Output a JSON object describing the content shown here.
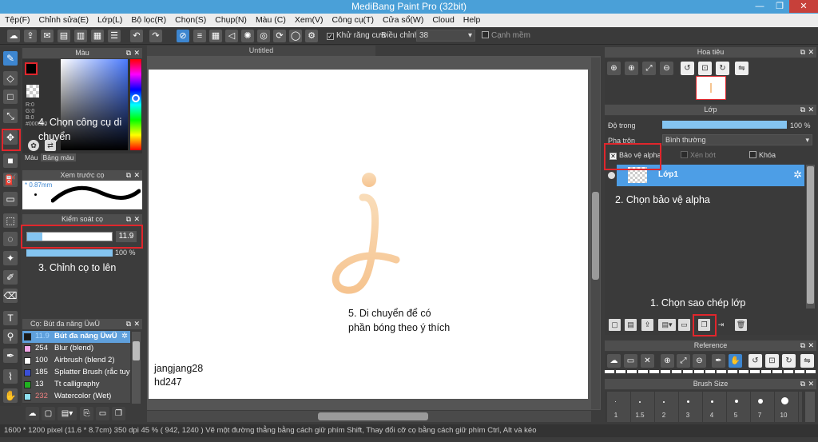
{
  "app": {
    "title": "MediBang Paint Pro (32bit)"
  },
  "menu": [
    "Tệp(F)",
    "Chỉnh sửa(E)",
    "Lớp(L)",
    "Bộ lọc(R)",
    "Chọn(S)",
    "Chụp(N)",
    "Màu (C)",
    "Xem(V)",
    "Công cụ(T)",
    "Cửa sổ(W)",
    "Cloud",
    "Help"
  ],
  "toolbar": {
    "antialias_label": "Khử răng cưa",
    "correction_label": "Điều chỉnh",
    "correction_value": "38",
    "snap_label": "Cạnh mềm"
  },
  "color_panel": {
    "title": "Màu",
    "r": "R:0",
    "g": "G:0",
    "b": "B:0",
    "hex": "#000000",
    "tab_color": "Màu",
    "tab_palette": "Bảng màu"
  },
  "preview_panel": {
    "title": "Xem trước cọ",
    "size": "0.87mm"
  },
  "brush_control": {
    "title": "Kiểm soát cọ",
    "size_value": "11.9",
    "opacity": "100 %",
    "size_fill": 0.18
  },
  "brush_list": {
    "title": "Cọ: Bút đa năng ÜwÜ",
    "items": [
      {
        "size": "11.9",
        "name": "Bút đa năng ÜwÜ",
        "color": "#1a1a1a"
      },
      {
        "size": "254",
        "name": "Blur (blend)",
        "color": "#f2a8e8"
      },
      {
        "size": "100",
        "name": "Airbrush (blend 2)",
        "color": "#ffffff"
      },
      {
        "size": "185",
        "name": "Splatter Brush (rắc tuyết)",
        "color": "#3a4fd8"
      },
      {
        "size": "13",
        "name": "Tt calligraphy",
        "color": "#20b020"
      },
      {
        "size": "232",
        "name": "Watercolor (Wet)",
        "color": "#8ee0f0"
      }
    ]
  },
  "canvas": {
    "tab": "Untitled",
    "watermark_line1": "jangjang28",
    "watermark_line2": "hd247"
  },
  "navigator": {
    "title": "Hoa tiêu"
  },
  "layer_panel": {
    "title": "Lớp",
    "opacity_label": "Độ trong",
    "opacity_value": "100 %",
    "opacity_fill": 1.0,
    "blend_label": "Pha trộn",
    "blend_value": "Bình thường",
    "alpha_lock": "Bảo vệ alpha",
    "clipping": "Xén bớt",
    "lock": "Khóa",
    "layer_name": "Lớp1"
  },
  "reference_panel": {
    "title": "Reference"
  },
  "brush_size_panel": {
    "title": "Brush Size",
    "sizes": [
      "1",
      "1.5",
      "2",
      "3",
      "4",
      "5",
      "7",
      "10"
    ]
  },
  "notes": {
    "n1": "1. Chọn sao chép lớp",
    "n2": "2. Chọn bảo vệ alpha",
    "n3": "3. Chỉnh cọ to lên",
    "n4a": "4. Chọn công cụ di",
    "n4b": "chuyển",
    "n5a": "5. Di chuyển để có",
    "n5b": "phần bóng theo ý thích"
  },
  "status": "1600 * 1200 pixel   (11.6 * 8.7cm)   350 dpi   45 %   ( 942, 1240 )   Vẽ một đường thẳng bằng cách giữ phím Shift, Thay đổi cỡ cọ bằng cách giữ phím Ctrl, Alt và kéo",
  "colors": {
    "accent": "#3d86d0",
    "annotation": "#e0262c",
    "glyph": "#f7c89a"
  }
}
